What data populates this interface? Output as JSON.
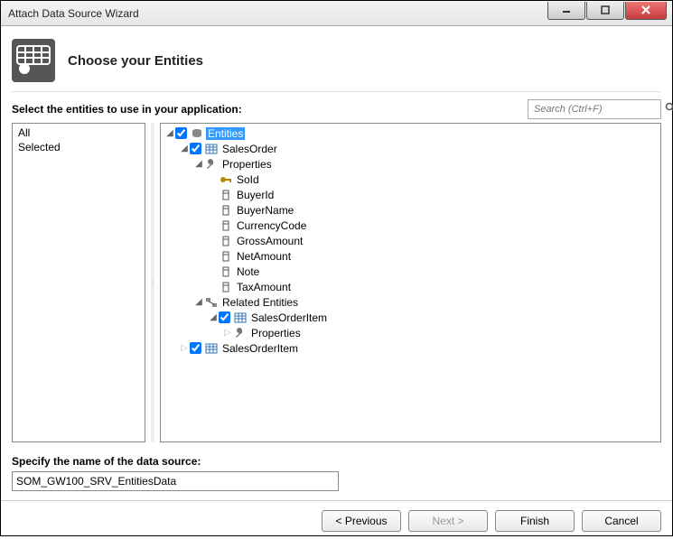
{
  "window": {
    "title": "Attach Data Source Wizard"
  },
  "header": {
    "title": "Choose your Entities"
  },
  "labels": {
    "select_entities": "Select the entities to use in your application:",
    "specify_name": "Specify the name of the data source:"
  },
  "search": {
    "placeholder": "Search (Ctrl+F)"
  },
  "filter_list": {
    "all": "All",
    "selected": "Selected"
  },
  "tree": {
    "root": "Entities",
    "sales_order": "SalesOrder",
    "properties": "Properties",
    "so_id": "SoId",
    "buyer_id": "BuyerId",
    "buyer_name": "BuyerName",
    "currency_code": "CurrencyCode",
    "gross_amount": "GrossAmount",
    "net_amount": "NetAmount",
    "note": "Note",
    "tax_amount": "TaxAmount",
    "related_entities": "Related Entities",
    "sales_order_item": "SalesOrderItem",
    "soi_properties": "Properties",
    "sales_order_item2": "SalesOrderItem"
  },
  "datasource_name": "SOM_GW100_SRV_EntitiesData",
  "buttons": {
    "previous": "< Previous",
    "next": "Next >",
    "finish": "Finish",
    "cancel": "Cancel"
  }
}
